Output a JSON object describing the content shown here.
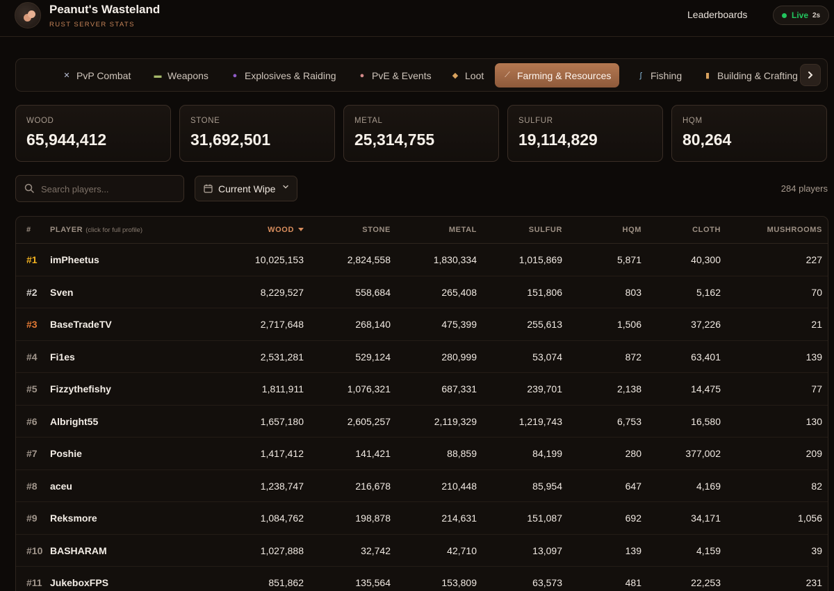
{
  "header": {
    "title": "Peanut's Wasteland",
    "subtitle": "RUST SERVER STATS",
    "nav_leaderboards": "Leaderboards",
    "live_label": "Live",
    "live_interval": "2s"
  },
  "tabs": [
    {
      "label": "PvP Combat",
      "icon": "crossed-swords-icon",
      "glyph": "✕",
      "color": "#b9c0d6"
    },
    {
      "label": "Weapons",
      "icon": "gun-icon",
      "glyph": "▬",
      "color": "#a6b86a"
    },
    {
      "label": "Explosives & Raiding",
      "icon": "bomb-icon",
      "glyph": "●",
      "color": "#8f5cc7"
    },
    {
      "label": "PvE & Events",
      "icon": "bear-icon",
      "glyph": "●",
      "color": "#d48a8a"
    },
    {
      "label": "Loot",
      "icon": "crate-icon",
      "glyph": "◆",
      "color": "#d9a25e"
    },
    {
      "label": "Farming & Resources",
      "icon": "pickaxe-icon",
      "glyph": "⟋",
      "color": "#f3d9c8",
      "active": true
    },
    {
      "label": "Fishing",
      "icon": "fishing-icon",
      "glyph": "ʃ",
      "color": "#8ec3e6"
    },
    {
      "label": "Building & Crafting",
      "icon": "crafting-icon",
      "glyph": "▮",
      "color": "#d9a25e"
    }
  ],
  "stats": [
    {
      "label": "WOOD",
      "value": "65,944,412"
    },
    {
      "label": "STONE",
      "value": "31,692,501"
    },
    {
      "label": "METAL",
      "value": "25,314,755"
    },
    {
      "label": "SULFUR",
      "value": "19,114,829"
    },
    {
      "label": "HQM",
      "value": "80,264"
    }
  ],
  "search": {
    "placeholder": "Search players..."
  },
  "wipe_filter": {
    "value": "Current Wipe"
  },
  "player_count": "284 players",
  "table": {
    "columns": {
      "rank": "#",
      "player": "PLAYER",
      "player_hint": "(click for full profile)",
      "wood": "WOOD",
      "stone": "STONE",
      "metal": "METAL",
      "sulfur": "SULFUR",
      "hqm": "HQM",
      "cloth": "CLOTH",
      "mushrooms": "MUSHROOMS"
    },
    "sorted_by": "wood",
    "rows": [
      {
        "rank": "#1",
        "player": "imPheetus",
        "wood": "10,025,153",
        "stone": "2,824,558",
        "metal": "1,830,334",
        "sulfur": "1,015,869",
        "hqm": "5,871",
        "cloth": "40,300",
        "mushrooms": "227"
      },
      {
        "rank": "#2",
        "player": "Sven",
        "wood": "8,229,527",
        "stone": "558,684",
        "metal": "265,408",
        "sulfur": "151,806",
        "hqm": "803",
        "cloth": "5,162",
        "mushrooms": "70"
      },
      {
        "rank": "#3",
        "player": "BaseTradeTV",
        "wood": "2,717,648",
        "stone": "268,140",
        "metal": "475,399",
        "sulfur": "255,613",
        "hqm": "1,506",
        "cloth": "37,226",
        "mushrooms": "21"
      },
      {
        "rank": "#4",
        "player": "Fi1es",
        "wood": "2,531,281",
        "stone": "529,124",
        "metal": "280,999",
        "sulfur": "53,074",
        "hqm": "872",
        "cloth": "63,401",
        "mushrooms": "139"
      },
      {
        "rank": "#5",
        "player": "Fizzythefishy",
        "wood": "1,811,911",
        "stone": "1,076,321",
        "metal": "687,331",
        "sulfur": "239,701",
        "hqm": "2,138",
        "cloth": "14,475",
        "mushrooms": "77"
      },
      {
        "rank": "#6",
        "player": "Albright55",
        "wood": "1,657,180",
        "stone": "2,605,257",
        "metal": "2,119,329",
        "sulfur": "1,219,743",
        "hqm": "6,753",
        "cloth": "16,580",
        "mushrooms": "130"
      },
      {
        "rank": "#7",
        "player": "Poshie",
        "wood": "1,417,412",
        "stone": "141,421",
        "metal": "88,859",
        "sulfur": "84,199",
        "hqm": "280",
        "cloth": "377,002",
        "mushrooms": "209"
      },
      {
        "rank": "#8",
        "player": "aceu",
        "wood": "1,238,747",
        "stone": "216,678",
        "metal": "210,448",
        "sulfur": "85,954",
        "hqm": "647",
        "cloth": "4,169",
        "mushrooms": "82"
      },
      {
        "rank": "#9",
        "player": "Reksmore",
        "wood": "1,084,762",
        "stone": "198,878",
        "metal": "214,631",
        "sulfur": "151,087",
        "hqm": "692",
        "cloth": "34,171",
        "mushrooms": "1,056"
      },
      {
        "rank": "#10",
        "player": "BASHARAM",
        "wood": "1,027,888",
        "stone": "32,742",
        "metal": "42,710",
        "sulfur": "13,097",
        "hqm": "139",
        "cloth": "4,159",
        "mushrooms": "39"
      },
      {
        "rank": "#11",
        "player": "JukeboxFPS",
        "wood": "851,862",
        "stone": "135,564",
        "metal": "153,809",
        "sulfur": "63,573",
        "hqm": "481",
        "cloth": "22,253",
        "mushrooms": "231"
      }
    ]
  }
}
